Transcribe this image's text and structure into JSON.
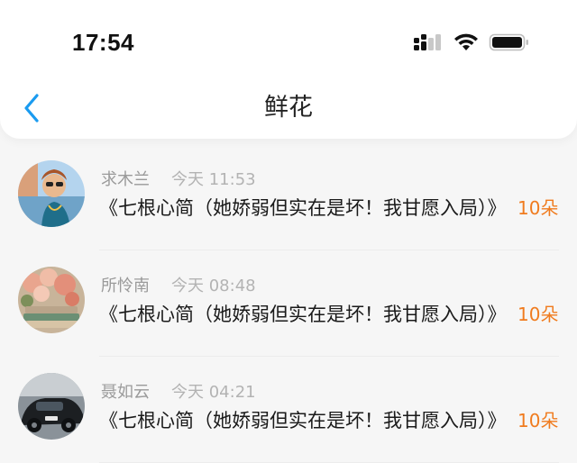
{
  "status_bar": {
    "time": "17:54",
    "signal_icon": "cellular-signal-icon",
    "wifi_icon": "wifi-icon",
    "battery_icon": "battery-icon"
  },
  "nav": {
    "back_icon": "chevron-left-icon",
    "title": "鲜花"
  },
  "colors": {
    "accent_blue": "#1a9bf0",
    "count_orange": "#f07b1e",
    "name_gray": "#9a9a9a",
    "time_gray": "#b3b3b3"
  },
  "items": [
    {
      "name": "求木兰",
      "time": "今天 11:53",
      "message": "《七根心简（她娇弱但实在是坏！我甘愿入局）》",
      "count": "10朵",
      "avatar_icon": "avatar-photo-woman"
    },
    {
      "name": "所怜南",
      "time": "今天 08:48",
      "message": "《七根心简（她娇弱但实在是坏！我甘愿入局）》",
      "count": "10朵",
      "avatar_icon": "avatar-photo-flowers"
    },
    {
      "name": "聂如云",
      "time": "今天 04:21",
      "message": "《七根心简（她娇弱但实在是坏！我甘愿入局）》",
      "count": "10朵",
      "avatar_icon": "avatar-photo-car"
    }
  ]
}
